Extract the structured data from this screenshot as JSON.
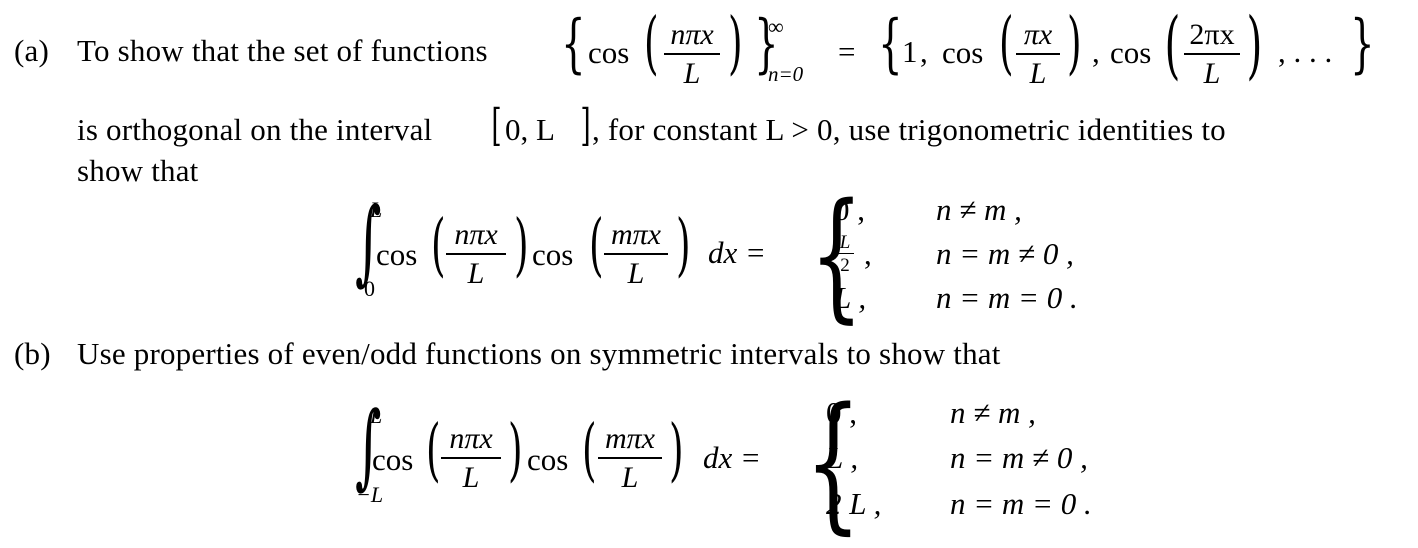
{
  "part_a": {
    "label": "(a)",
    "intro": "To show that the set of functions",
    "set_expr": {
      "open_brace": "{",
      "cos": "cos",
      "frac_num": "nπx",
      "frac_den": "L",
      "close_brace": "}",
      "sup": "∞",
      "sub": "n=0",
      "equals": "=",
      "elements": {
        "first": "1",
        "comma": ",",
        "cos1": "cos",
        "frac1_num": "πx",
        "frac1_den": "L",
        "cos2": "cos",
        "frac2_num": "2πx",
        "frac2_den": "L",
        "ellipsis": ", . . .",
        "close": "}"
      }
    },
    "line2": "is orthogonal on the interval",
    "interval_open": "[",
    "interval_content": "0, L",
    "interval_close": "]",
    "line2_rest": ", for constant L > 0, use trigonometric identities to",
    "line3": "show that",
    "integral": {
      "upper": "L",
      "lower": "0",
      "cos_a": "cos",
      "num_a": "nπx",
      "den_a": "L",
      "cos_b": "cos",
      "num_b": "mπx",
      "den_b": "L",
      "dx": "dx =",
      "cases": [
        {
          "value": "0 ,",
          "condition": "n ≠ m ,"
        },
        {
          "value_num": "L",
          "value_den": "2",
          "value_suffix": ",",
          "condition": "n = m ≠ 0 ,"
        },
        {
          "value": "L ,",
          "condition": "n = m = 0 ."
        }
      ]
    }
  },
  "part_b": {
    "label": "(b)",
    "text": "Use properties of even/odd functions on symmetric intervals to show that",
    "integral": {
      "upper": "L",
      "lower": "−L",
      "cos_a": "cos",
      "num_a": "nπx",
      "den_a": "L",
      "cos_b": "cos",
      "num_b": "mπx",
      "den_b": "L",
      "dx": "dx =",
      "cases": [
        {
          "value": "0 ,",
          "condition": "n ≠ m ,"
        },
        {
          "value": "L ,",
          "condition": "n = m ≠ 0 ,"
        },
        {
          "value": "2 L ,",
          "condition": "n = m = 0 ."
        }
      ]
    }
  }
}
